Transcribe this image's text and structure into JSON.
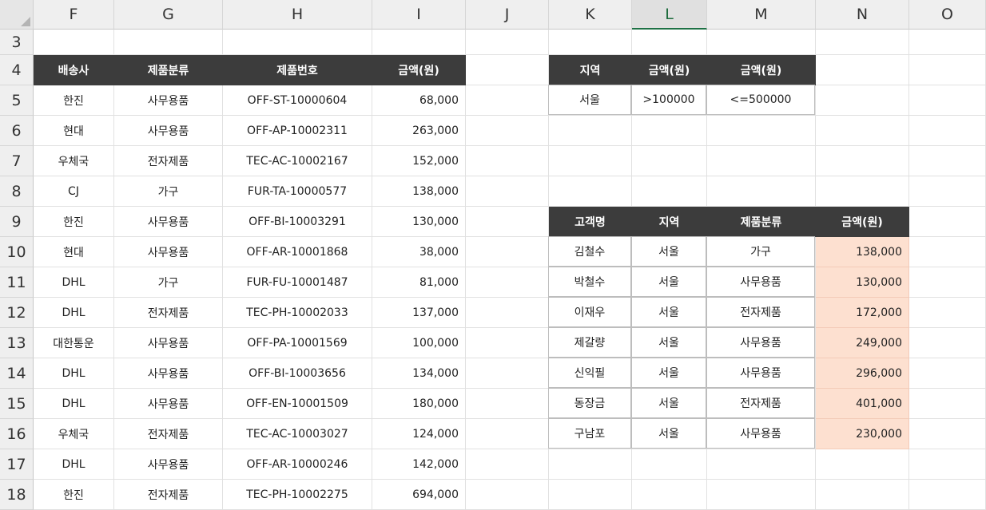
{
  "columns": [
    "F",
    "G",
    "H",
    "I",
    "J",
    "K",
    "L",
    "M",
    "N",
    "O"
  ],
  "active_column": "L",
  "rows": [
    "3",
    "4",
    "5",
    "6",
    "7",
    "8",
    "9",
    "10",
    "11",
    "12",
    "13",
    "14",
    "15",
    "16",
    "17",
    "18"
  ],
  "left_table": {
    "headers": [
      "배송사",
      "제품분류",
      "제품번호",
      "금액(원)"
    ],
    "rows": [
      [
        "한진",
        "사무용품",
        "OFF-ST-10000604",
        "68,000"
      ],
      [
        "현대",
        "사무용품",
        "OFF-AP-10002311",
        "263,000"
      ],
      [
        "우체국",
        "전자제품",
        "TEC-AC-10002167",
        "152,000"
      ],
      [
        "CJ",
        "가구",
        "FUR-TA-10000577",
        "138,000"
      ],
      [
        "한진",
        "사무용품",
        "OFF-BI-10003291",
        "130,000"
      ],
      [
        "현대",
        "사무용품",
        "OFF-AR-10001868",
        "38,000"
      ],
      [
        "DHL",
        "가구",
        "FUR-FU-10001487",
        "81,000"
      ],
      [
        "DHL",
        "전자제품",
        "TEC-PH-10002033",
        "137,000"
      ],
      [
        "대한통운",
        "사무용품",
        "OFF-PA-10001569",
        "100,000"
      ],
      [
        "DHL",
        "사무용품",
        "OFF-BI-10003656",
        "134,000"
      ],
      [
        "DHL",
        "사무용품",
        "OFF-EN-10001509",
        "180,000"
      ],
      [
        "우체국",
        "전자제품",
        "TEC-AC-10003027",
        "124,000"
      ],
      [
        "DHL",
        "사무용품",
        "OFF-AR-10000246",
        "142,000"
      ],
      [
        "한진",
        "전자제품",
        "TEC-PH-10002275",
        "694,000"
      ]
    ]
  },
  "criteria_table": {
    "headers": [
      "지역",
      "금액(원)",
      "금액(원)"
    ],
    "row": [
      "서울",
      ">100000",
      "<=500000"
    ]
  },
  "result_table": {
    "headers": [
      "고객명",
      "지역",
      "제품분류",
      "금액(원)"
    ],
    "rows": [
      [
        "김철수",
        "서울",
        "가구",
        "138,000"
      ],
      [
        "박철수",
        "서울",
        "사무용품",
        "130,000"
      ],
      [
        "이재우",
        "서울",
        "전자제품",
        "172,000"
      ],
      [
        "제갈량",
        "서울",
        "사무용품",
        "249,000"
      ],
      [
        "신익필",
        "서울",
        "사무용품",
        "296,000"
      ],
      [
        "동장금",
        "서울",
        "전자제품",
        "401,000"
      ],
      [
        "구남포",
        "서울",
        "사무용품",
        "230,000"
      ]
    ],
    "highlight_color": "#fde0d0"
  },
  "colors": {
    "header_bg": "#3c3c3c",
    "header_text": "#ffffff",
    "active_col": "#1e7145"
  }
}
